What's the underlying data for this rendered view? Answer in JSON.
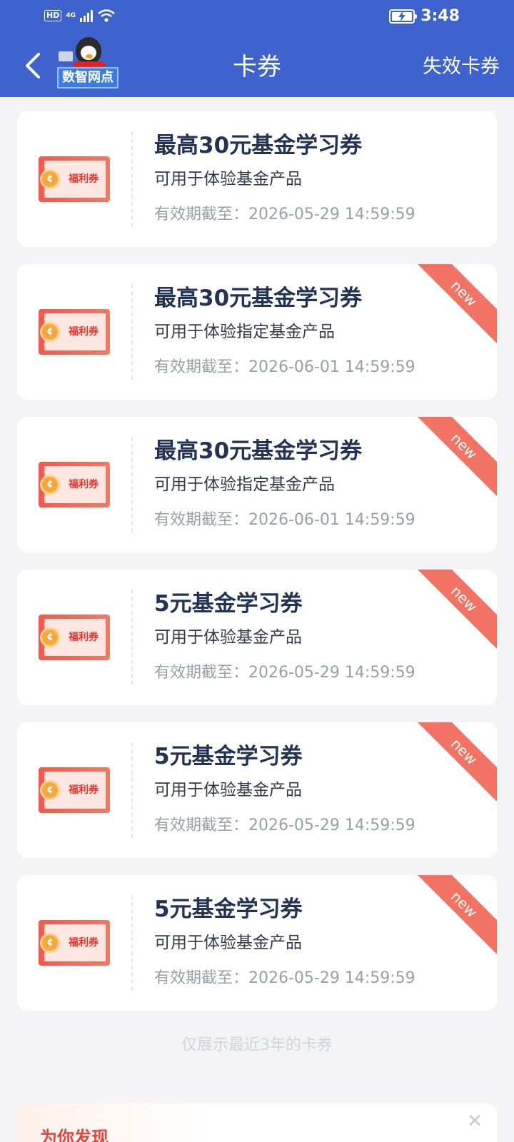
{
  "status_bar": {
    "hd": "HD",
    "network": "4G",
    "time": "3:48"
  },
  "header": {
    "title": "卡券",
    "expired_link": "失效卡券",
    "mascot_label": "数智网点"
  },
  "coupons": [
    {
      "icon_label": "福利券",
      "title": "最高30元基金学习券",
      "desc": "可用于体验基金产品",
      "expiry": "有效期截至：2026-05-29 14:59:59",
      "badge": ""
    },
    {
      "icon_label": "福利券",
      "title": "最高30元基金学习券",
      "desc": "可用于体验指定基金产品",
      "expiry": "有效期截至：2026-06-01 14:59:59",
      "badge": "new"
    },
    {
      "icon_label": "福利券",
      "title": "最高30元基金学习券",
      "desc": "可用于体验指定基金产品",
      "expiry": "有效期截至：2026-06-01 14:59:59",
      "badge": "new"
    },
    {
      "icon_label": "福利券",
      "title": "5元基金学习券",
      "desc": "可用于体验基金产品",
      "expiry": "有效期截至：2026-05-29 14:59:59",
      "badge": "new"
    },
    {
      "icon_label": "福利券",
      "title": "5元基金学习券",
      "desc": "可用于体验基金产品",
      "expiry": "有效期截至：2026-05-29 14:59:59",
      "badge": "new"
    },
    {
      "icon_label": "福利券",
      "title": "5元基金学习券",
      "desc": "可用于体验基金产品",
      "expiry": "有效期截至：2026-05-29 14:59:59",
      "badge": "new"
    }
  ],
  "footer_note": "仅展示最近3年的卡券",
  "discover": {
    "title": "为你发现",
    "close_icon": "close-icon"
  },
  "colors": {
    "header_bg": "#3e63cf",
    "ribbon": "#f27264",
    "title_text": "#233356"
  }
}
